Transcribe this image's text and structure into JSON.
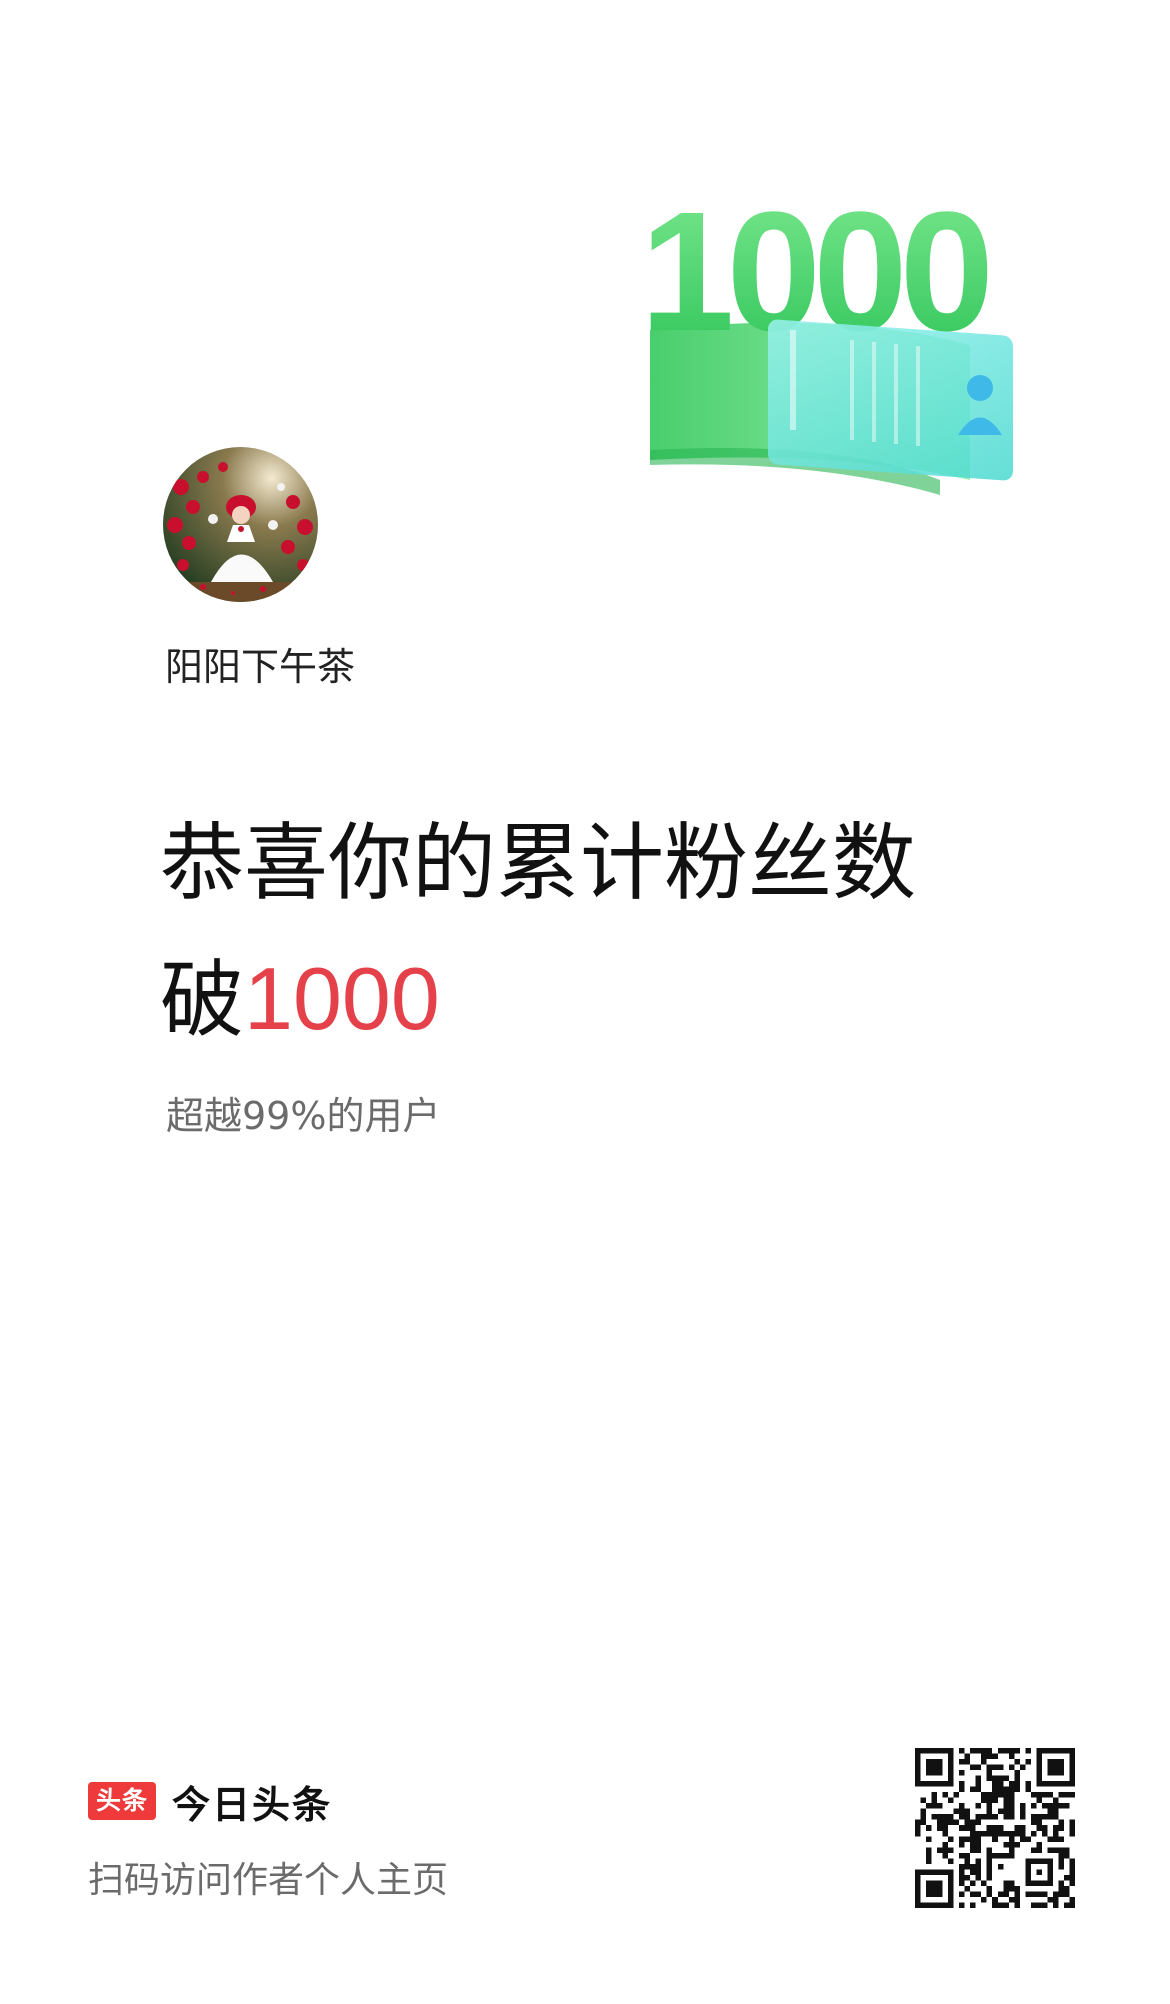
{
  "hero": {
    "badge_number": "1000"
  },
  "profile": {
    "username": "阳阳下午茶"
  },
  "headline": {
    "line1": "恭喜你的累计粉丝数",
    "line2_prefix": "破",
    "number": "1000"
  },
  "subtext": "超越99%的用户",
  "footer": {
    "brand_badge": "头条",
    "brand_name": "今日头条",
    "caption": "扫码访问作者个人主页"
  },
  "colors": {
    "accent_red": "#e5414a",
    "brand_red": "#ee3a3a",
    "badge_green": "#43d66e",
    "card_cyan": "#6fe6e0"
  },
  "icons": [
    "avatar-photo",
    "user-icon",
    "qr-code"
  ]
}
